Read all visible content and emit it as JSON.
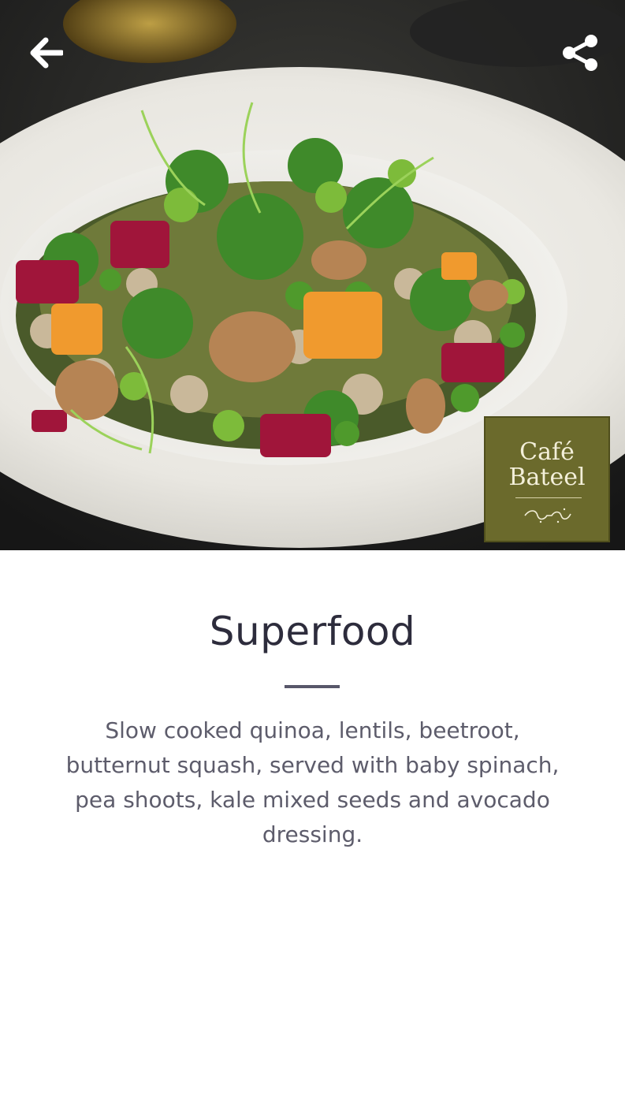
{
  "header": {
    "back_icon": "arrow-left-icon",
    "share_icon": "share-icon"
  },
  "hero": {
    "image_subject": "salad-dish-photo"
  },
  "brand": {
    "line1": "Café",
    "line2": "Bateel",
    "script": "بـتـيـل",
    "color": "#6b6a2c"
  },
  "item": {
    "title": "Superfood",
    "description": "Slow cooked quinoa, lentils, beetroot, butternut squash, served with baby spinach, pea shoots, kale mixed seeds and avocado dressing."
  },
  "colors": {
    "title": "#2d2c3c",
    "description": "#5d5c6b",
    "divider": "#58576a"
  }
}
